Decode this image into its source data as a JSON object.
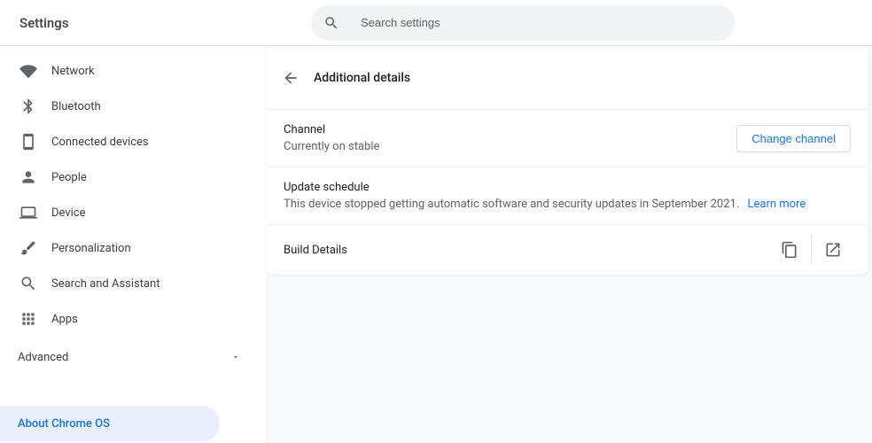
{
  "header": {
    "title": "Settings",
    "search_placeholder": "Search settings"
  },
  "sidebar": {
    "items": [
      {
        "label": "Network"
      },
      {
        "label": "Bluetooth"
      },
      {
        "label": "Connected devices"
      },
      {
        "label": "People"
      },
      {
        "label": "Device"
      },
      {
        "label": "Personalization"
      },
      {
        "label": "Search and Assistant"
      },
      {
        "label": "Apps"
      }
    ],
    "advanced_label": "Advanced",
    "about_label": "About Chrome OS"
  },
  "page": {
    "title": "Additional details",
    "channel": {
      "label": "Channel",
      "sub": "Currently on stable",
      "button": "Change channel"
    },
    "update": {
      "label": "Update schedule",
      "sub": "This device stopped getting automatic software and security updates in September 2021.",
      "learn_more": "Learn more"
    },
    "build": {
      "label": "Build Details"
    }
  }
}
